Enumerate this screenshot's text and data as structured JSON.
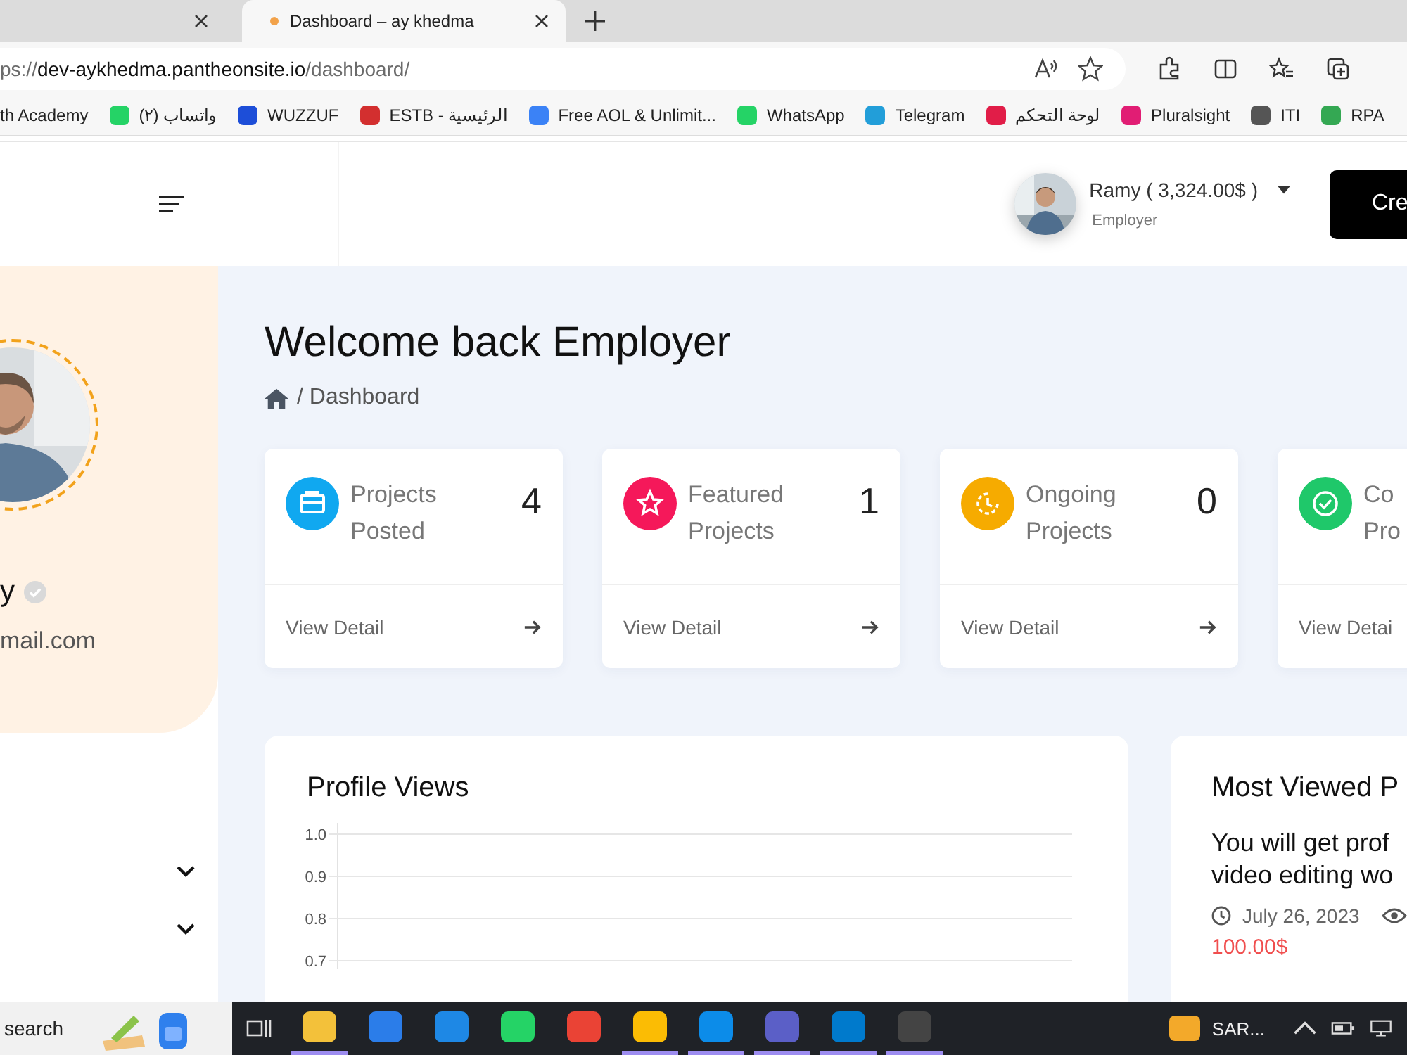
{
  "browser": {
    "tabs": [
      {
        "selected": false
      },
      {
        "title": "Dashboard – ay khedma",
        "selected": true
      }
    ],
    "address": {
      "scheme": "ps://",
      "host": "dev-aykhedma.pantheonsite.io",
      "path": "/dashboard/"
    },
    "bookmarks": [
      {
        "label": "th Academy"
      },
      {
        "label": "(٢) واتساب",
        "color": "#25d366"
      },
      {
        "label": "WUZZUF",
        "color": "#1d4ed8"
      },
      {
        "label": "ESTB - الرئيسية",
        "color": "#d32f2f"
      },
      {
        "label": "Free AOL & Unlimit...",
        "color": "#3b82f6"
      },
      {
        "label": "WhatsApp",
        "color": "#25d366"
      },
      {
        "label": "Telegram",
        "color": "#229ed9"
      },
      {
        "label": "لوحة التحكم",
        "color": "#e11d48"
      },
      {
        "label": "Pluralsight",
        "color": "#e11d74"
      },
      {
        "label": "ITI",
        "color": "#555555"
      },
      {
        "label": "RPA",
        "color": "#34a853"
      }
    ]
  },
  "header": {
    "user": "Ramy ( 3,324.00$ )",
    "role": "Employer",
    "button": "Cre"
  },
  "sidebar": {
    "name": "y",
    "verified": true,
    "email": "mail.com"
  },
  "page": {
    "title": "Welcome back Employer",
    "breadcrumb": "/ Dashboard"
  },
  "stats": [
    {
      "kind": "briefcase",
      "color": "#10a8f0",
      "label_lines": [
        "Projects",
        "Posted"
      ],
      "number": "4",
      "link": "View Detail"
    },
    {
      "kind": "star",
      "color": "#f5185a",
      "label_lines": [
        "Featured",
        "Projects"
      ],
      "number": "1",
      "link": "View Detail"
    },
    {
      "kind": "clock",
      "color": "#f6ab00",
      "label_lines": [
        "Ongoing",
        "Projects"
      ],
      "number": "0",
      "link": "View Detail"
    },
    {
      "kind": "check",
      "color": "#1fc86a",
      "label_lines": [
        "Co",
        "Pro"
      ],
      "link": "View Detai"
    }
  ],
  "profile_views": {
    "title": "Profile Views",
    "axis_labels": [
      "1.0",
      "0.9",
      "0.8",
      "0.7"
    ]
  },
  "most_viewed": {
    "title": "Most Viewed P",
    "job_lines": [
      "You will get prof",
      "video editing wo"
    ],
    "date": "July 26, 2023",
    "price": "100.00$"
  },
  "taskbar": {
    "search": "search",
    "apps": [
      {
        "color": "#f3c13a",
        "running": true
      },
      {
        "color": "#2b7de9",
        "running": false
      },
      {
        "color": "#1e88e5",
        "running": false
      },
      {
        "color": "#25d366",
        "running": false
      },
      {
        "color": "#ea4335",
        "running": false
      },
      {
        "color": "#fbbc04",
        "running": true
      },
      {
        "color": "#0c8ce9",
        "running": true
      },
      {
        "color": "#5b5fc7",
        "running": true
      },
      {
        "color": "#007acc",
        "running": true
      },
      {
        "color": "#444444",
        "running": true
      }
    ],
    "weather": "SAR..."
  }
}
